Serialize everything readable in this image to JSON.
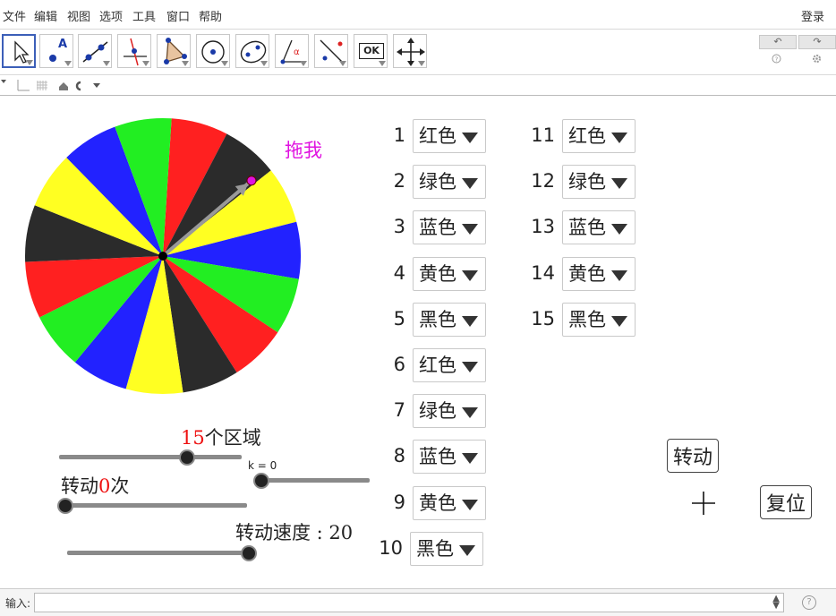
{
  "menu": {
    "items": [
      "文件",
      "编辑",
      "视图",
      "选项",
      "工具",
      "窗口",
      "帮助"
    ],
    "login": "登录"
  },
  "toolbar": {
    "tools": [
      "move-tool",
      "point-tool",
      "line-tool",
      "perpendicular-tool",
      "polygon-tool",
      "circle-tool",
      "conic-tool",
      "angle-tool",
      "reflect-tool",
      "button-tool",
      "move-view-tool"
    ],
    "ok_label": "OK",
    "point_label": "A",
    "angle_label": "α",
    "undo": "↶",
    "redo": "↷"
  },
  "wheel": {
    "sector_count": 15,
    "colors": [
      "#ff2020",
      "#2b2b2b",
      "#ffff22",
      "#2222ff",
      "#22ee22",
      "#ff2020",
      "#2b2b2b",
      "#ffff22",
      "#2222ff",
      "#22ee22",
      "#ff2020",
      "#2b2b2b",
      "#ffff22",
      "#2222ff",
      "#22ee22"
    ],
    "drag_label": "拖我"
  },
  "regions": {
    "count_value": "15",
    "count_suffix": "个区域",
    "slider_fraction": 0.7
  },
  "k_slider": {
    "label": "k = 0",
    "fraction": 0
  },
  "spin_count": {
    "prefix": "转动",
    "value": "0",
    "suffix": "次",
    "fraction": 0
  },
  "speed": {
    "label": "转动速度 : 20",
    "fraction": 1
  },
  "sector_options": [
    {
      "num": "1",
      "color": "红色"
    },
    {
      "num": "2",
      "color": "绿色"
    },
    {
      "num": "3",
      "color": "蓝色"
    },
    {
      "num": "4",
      "color": "黄色"
    },
    {
      "num": "5",
      "color": "黑色"
    },
    {
      "num": "6",
      "color": "红色"
    },
    {
      "num": "7",
      "color": "绿色"
    },
    {
      "num": "8",
      "color": "蓝色"
    },
    {
      "num": "9",
      "color": "黄色"
    },
    {
      "num": "10",
      "color": "黑色"
    },
    {
      "num": "11",
      "color": "红色"
    },
    {
      "num": "12",
      "color": "绿色"
    },
    {
      "num": "13",
      "color": "蓝色"
    },
    {
      "num": "14",
      "color": "黄色"
    },
    {
      "num": "15",
      "color": "黑色"
    }
  ],
  "buttons": {
    "spin": "转动",
    "reset": "复位"
  },
  "inputbar": {
    "label": "输入:"
  }
}
